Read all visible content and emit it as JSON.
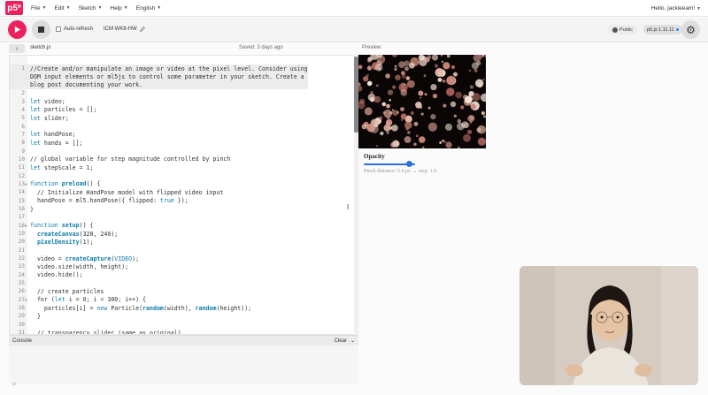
{
  "nav": {
    "logo": "p5*",
    "menu": [
      {
        "label": "File"
      },
      {
        "label": "Edit"
      },
      {
        "label": "Sketch"
      },
      {
        "label": "Help"
      },
      {
        "label": "English"
      }
    ],
    "user": "Hello, jackieeam!"
  },
  "toolbar": {
    "auto_refresh": "Auto-refresh",
    "sketch_name": "ICM WK8-HW",
    "visibility": "Public",
    "version": "p5.js 1.11.11",
    "icons": {
      "play": "play-icon",
      "stop": "stop-icon",
      "settings": "gear-icon",
      "edit": "pencil-icon",
      "visibility": "globe-icon"
    }
  },
  "editor": {
    "filename": "sketch.js",
    "saved": "Saved: 3 days ago",
    "lines": [
      {
        "n": "1",
        "text": "//Create and/or manipulate an image or video at the pixel level. Consider using",
        "type": "cm"
      },
      {
        "n": "",
        "text": "DOM input elements or ml5js to control some parameter in your sketch. Create a",
        "type": "cm"
      },
      {
        "n": "",
        "text": "blog post documenting your work.",
        "type": "cm"
      },
      {
        "n": "2",
        "text": "",
        "type": "plain"
      },
      {
        "n": "3",
        "text": "let video;",
        "type": "let"
      },
      {
        "n": "4",
        "text": "let particles = [];",
        "type": "let"
      },
      {
        "n": "5",
        "text": "let slider;",
        "type": "let"
      },
      {
        "n": "6",
        "text": "",
        "type": "plain"
      },
      {
        "n": "7",
        "text": "let handPose;",
        "type": "let"
      },
      {
        "n": "8",
        "text": "let hands = [];",
        "type": "let"
      },
      {
        "n": "9",
        "text": "",
        "type": "plain"
      },
      {
        "n": "10",
        "text": "// global variable for step magnitude controlled by pinch",
        "type": "cm"
      },
      {
        "n": "11",
        "text": "let stepScale = 1;",
        "type": "let"
      },
      {
        "n": "12",
        "text": "",
        "type": "plain"
      },
      {
        "n": "13",
        "text": "function preload() {",
        "type": "func",
        "fold": true
      },
      {
        "n": "14",
        "text": "  // Initialize HandPose model with flipped video input",
        "type": "cm"
      },
      {
        "n": "15",
        "text": "  handPose = ml5.handPose({ flipped: true });",
        "type": "plain"
      },
      {
        "n": "16",
        "text": "}",
        "type": "plain"
      },
      {
        "n": "17",
        "text": "",
        "type": "plain"
      },
      {
        "n": "18",
        "text": "function setup() {",
        "type": "func",
        "fold": true
      },
      {
        "n": "19",
        "text": "  createCanvas(320, 240);",
        "type": "call"
      },
      {
        "n": "20",
        "text": "  pixelDensity(1);",
        "type": "call"
      },
      {
        "n": "21",
        "text": "",
        "type": "plain"
      },
      {
        "n": "22",
        "text": "  video = createCapture(VIDEO);",
        "type": "plain"
      },
      {
        "n": "23",
        "text": "  video.size(width, height);",
        "type": "plain"
      },
      {
        "n": "24",
        "text": "  video.hide();",
        "type": "plain"
      },
      {
        "n": "25",
        "text": "",
        "type": "plain"
      },
      {
        "n": "26",
        "text": "  // create particles",
        "type": "cm"
      },
      {
        "n": "27",
        "text": "  for (let i = 0; i < 300; i++) {",
        "type": "plain",
        "fold": true
      },
      {
        "n": "28",
        "text": "    particles[i] = new Particle(random(width), random(height));",
        "type": "plain"
      },
      {
        "n": "29",
        "text": "  }",
        "type": "plain"
      },
      {
        "n": "30",
        "text": "",
        "type": "plain"
      },
      {
        "n": "31",
        "text": "  // transparency slider (same as original)",
        "type": "cm"
      }
    ]
  },
  "console": {
    "title": "Console",
    "clear": "Clear",
    "prompt": ">"
  },
  "preview": {
    "label": "Preview",
    "slider_label": "Opacity",
    "slider_value": 0.88,
    "pinch_text": "Pinch distance: 5.4 px → step: 1.0"
  },
  "colors": {
    "accent": "#ed225d",
    "slider": "#2a6fdb",
    "keyword": "#0b7ca9"
  }
}
